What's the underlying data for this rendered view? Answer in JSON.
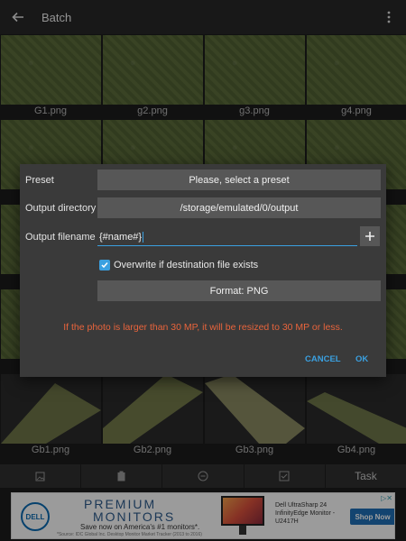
{
  "appbar": {
    "title": "Batch"
  },
  "thumbnails": {
    "row1": [
      "G1.png",
      "g2.png",
      "g3.png",
      "g4.png"
    ],
    "row_last": [
      "Gb1.png",
      "Gb2.png",
      "Gb3.png",
      "Gb4.png"
    ]
  },
  "dialog": {
    "preset_label": "Preset",
    "preset_value": "Please, select a preset",
    "output_dir_label": "Output directory",
    "output_dir_value": "/storage/emulated/0/output",
    "output_filename_label": "Output filename",
    "output_filename_value": "{#name#}",
    "overwrite_label": "Overwrite if destination file exists",
    "overwrite_checked": true,
    "format_button": "Format: PNG",
    "warning": "If the photo is larger than 30 MP, it will be resized to 30 MP or less.",
    "cancel": "CANCEL",
    "ok": "OK"
  },
  "toolbar": {
    "task_label": "Task"
  },
  "ad": {
    "brand": "DELL",
    "headline_1": "PREMIUM",
    "headline_2": "MONITORS",
    "tagline": "Save now on America's #1 monitors*.",
    "source": "*Source: IDC Global Inc. Desktop Monitor Market Tracker (2013 to 2016)",
    "product": "Dell UltraSharp 24 InfinityEdge Monitor - U2417H",
    "cta": "Shop Now"
  },
  "colors": {
    "accent": "#3aa0e0",
    "warning": "#e8643c",
    "dialog_bg": "#3a3a3a",
    "button_bg": "#575757"
  }
}
